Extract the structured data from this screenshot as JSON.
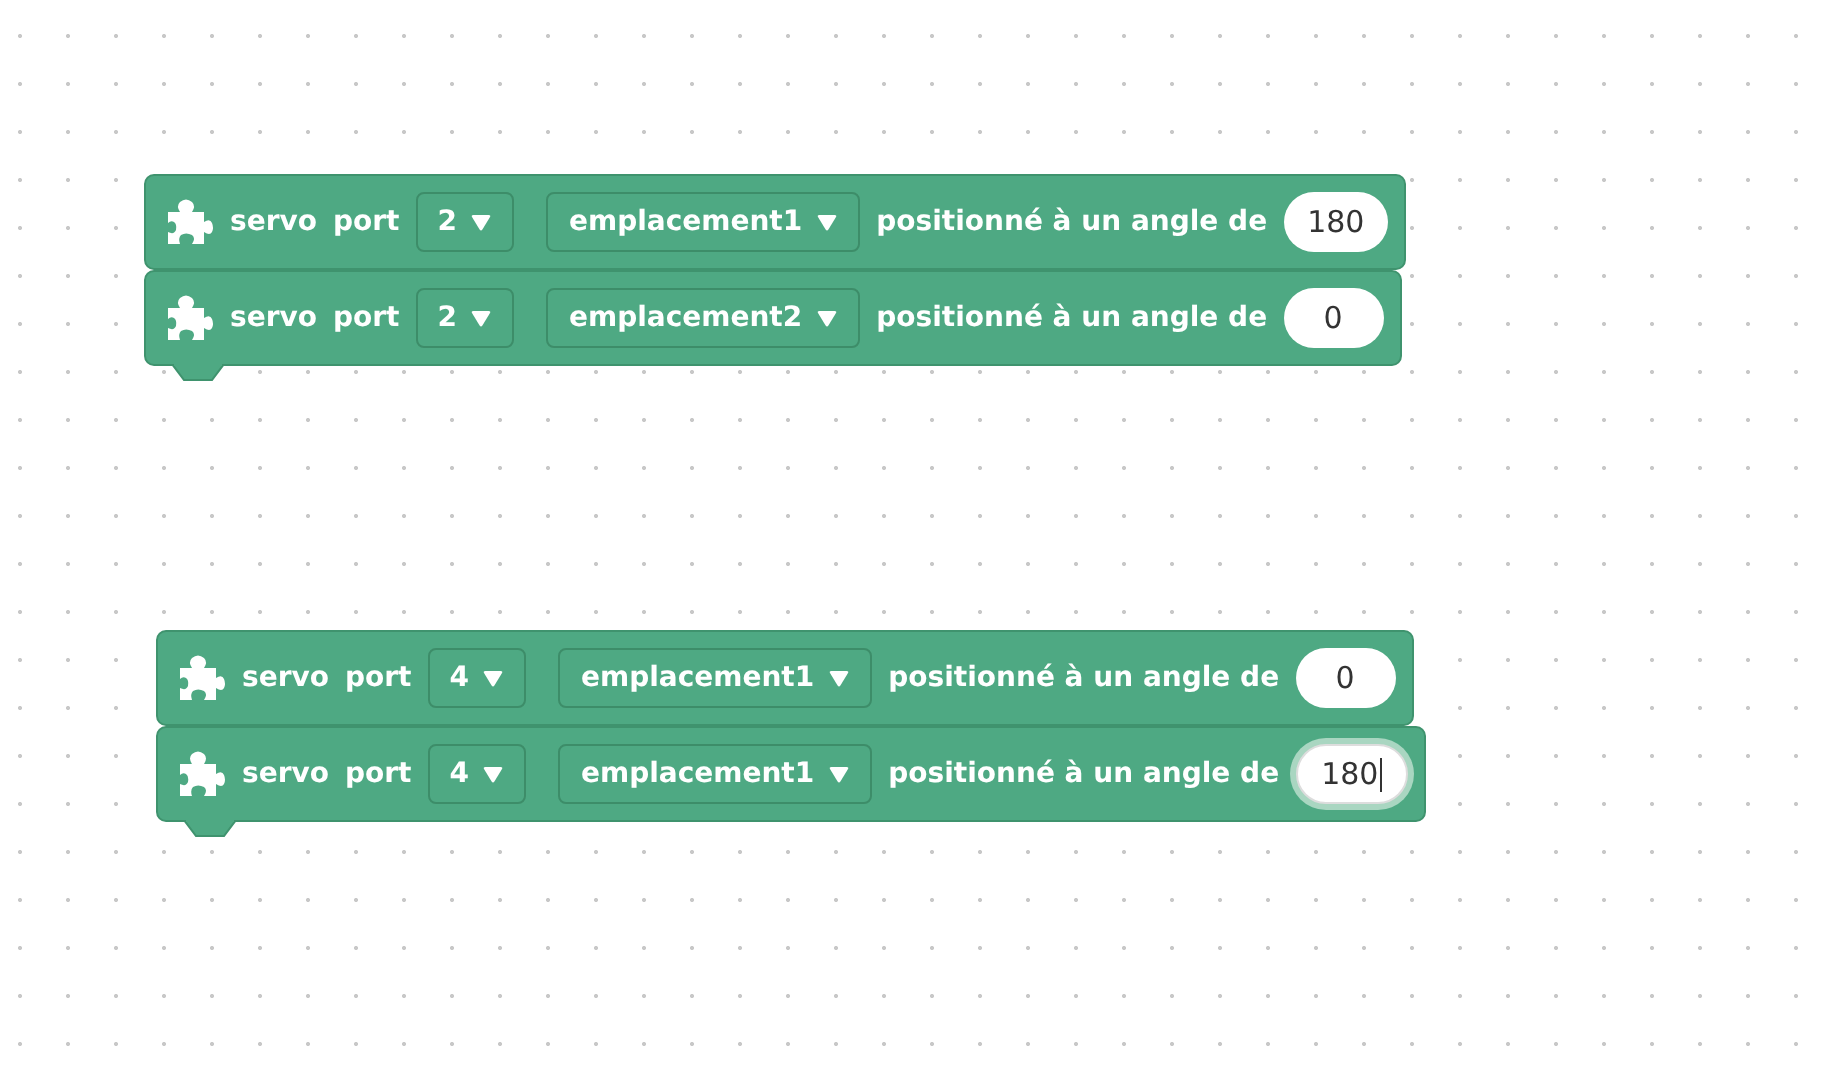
{
  "stacks": [
    {
      "blocks": [
        {
          "word_1": "servo",
          "word_2": "port",
          "port": "2",
          "slot": "emplacement1",
          "phrase": "positionné à un angle de",
          "angle": "180",
          "editing": false
        },
        {
          "word_1": "servo",
          "word_2": "port",
          "port": "2",
          "slot": "emplacement2",
          "phrase": "positionné à un angle de",
          "angle": "0",
          "editing": false
        }
      ]
    },
    {
      "blocks": [
        {
          "word_1": "servo",
          "word_2": "port",
          "port": "4",
          "slot": "emplacement1",
          "phrase": "positionné à un angle de",
          "angle": "0",
          "editing": false
        },
        {
          "word_1": "servo",
          "word_2": "port",
          "port": "4",
          "slot": "emplacement1",
          "phrase": "positionné à un angle de",
          "angle": "180",
          "editing": true
        }
      ]
    }
  ]
}
